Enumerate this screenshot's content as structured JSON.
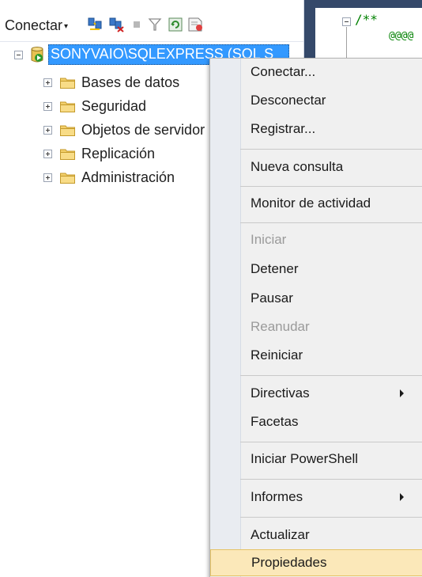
{
  "toolbar": {
    "connect_label": "Conectar",
    "icons": [
      "connect-object-explorer-icon",
      "disconnect-icon",
      "stop-icon",
      "filter-icon",
      "refresh-icon",
      "summary-report-icon"
    ]
  },
  "tree": {
    "server": {
      "label": "SONYVAIO\\SQLEXPRESS (SQL S",
      "expanded": true
    },
    "children": [
      {
        "label": "Bases de datos"
      },
      {
        "label": "Seguridad"
      },
      {
        "label": "Objetos de servidor"
      },
      {
        "label": "Replicación"
      },
      {
        "label": "Administración"
      }
    ]
  },
  "editor": {
    "line1": "/**",
    "line2": "@@@@"
  },
  "context_menu": {
    "items": [
      {
        "label": "Conectar...",
        "enabled": true
      },
      {
        "label": "Desconectar",
        "enabled": true
      },
      {
        "label": "Registrar...",
        "enabled": true
      },
      {
        "label": "Nueva consulta",
        "enabled": true
      },
      {
        "label": "Monitor de actividad",
        "enabled": true
      },
      {
        "label": "Iniciar",
        "enabled": false
      },
      {
        "label": "Detener",
        "enabled": true
      },
      {
        "label": "Pausar",
        "enabled": true
      },
      {
        "label": "Reanudar",
        "enabled": false
      },
      {
        "label": "Reiniciar",
        "enabled": true
      },
      {
        "label": "Directivas",
        "enabled": true,
        "submenu": true
      },
      {
        "label": "Facetas",
        "enabled": true
      },
      {
        "label": "Iniciar PowerShell",
        "enabled": true
      },
      {
        "label": "Informes",
        "enabled": true,
        "submenu": true
      },
      {
        "label": "Actualizar",
        "enabled": true
      },
      {
        "label": "Propiedades",
        "enabled": true,
        "highlighted": true
      }
    ]
  },
  "colors": {
    "selection": "#3399ff",
    "menu_background": "#f0f0f0",
    "menu_highlight": "#fbe8b9",
    "disabled_text": "#9a9a9a",
    "editor_frame": "#35496a",
    "comment_green": "#008000"
  }
}
